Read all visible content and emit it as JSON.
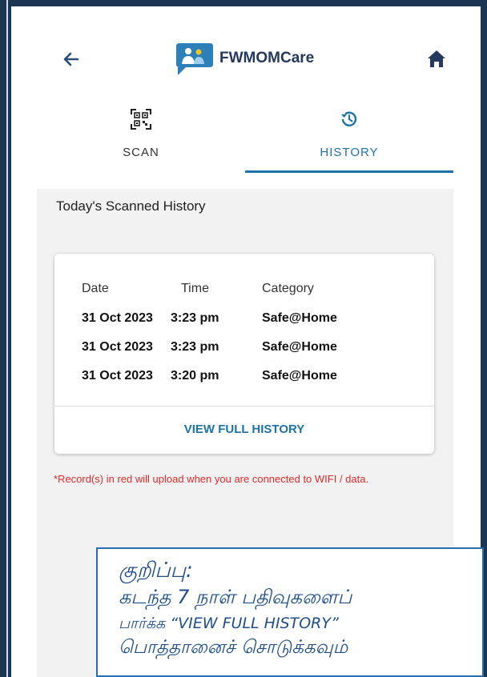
{
  "app": {
    "title": "FWMOMCare"
  },
  "icons": {
    "back": "arrow-left-icon",
    "home": "home-icon",
    "logo": "fwmomcare-logo-icon",
    "scan": "qr-code-icon",
    "history": "history-icon"
  },
  "colors": {
    "accent": "#1d73a8",
    "brand": "#24395b",
    "warning": "#e02a2a",
    "overlay_text": "#1e4f8c"
  },
  "tabs": [
    {
      "label": "SCAN",
      "selected": false
    },
    {
      "label": "HISTORY",
      "selected": true
    }
  ],
  "history": {
    "section_title": "Today's Scanned History",
    "columns": [
      "Date",
      "Time",
      "Category"
    ],
    "rows": [
      [
        "31 Oct 2023",
        "3:23 pm",
        "Safe@Home"
      ],
      [
        "31 Oct 2023",
        "3:23 pm",
        "Safe@Home"
      ],
      [
        "31 Oct 2023",
        "3:20 pm",
        "Safe@Home"
      ]
    ],
    "view_full_label": "VIEW FULL HISTORY",
    "note": "*Record(s) in red will upload when you are connected to WIFI / data."
  },
  "tip": {
    "heading": "குறிப்பு:",
    "line1": "கடந்த 7 நாள் பதிவுகளைப்",
    "line2": "பார்க்க “VIEW FULL HISTORY”",
    "line3": "பொத்தானைச் சொடுக்கவும்"
  }
}
